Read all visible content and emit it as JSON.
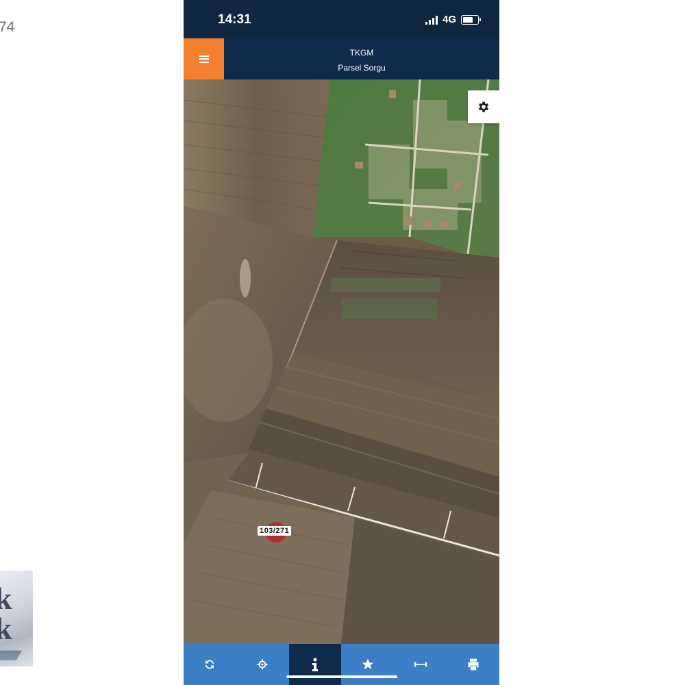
{
  "background": {
    "fragment_number": "74"
  },
  "status_bar": {
    "time": "14:31",
    "network": "4G"
  },
  "header": {
    "title": "TKGM",
    "subtitle": "Parsel Sorgu",
    "menu_icon": "hamburger-menu-icon"
  },
  "map": {
    "settings_icon": "gear-icon",
    "parcel_label": "103/271"
  },
  "toolbar": {
    "items": [
      {
        "icon": "refresh-icon",
        "active": false
      },
      {
        "icon": "locate-icon",
        "active": false
      },
      {
        "icon": "info-icon",
        "active": true
      },
      {
        "icon": "star-icon",
        "active": false
      },
      {
        "icon": "measure-icon",
        "active": false
      },
      {
        "icon": "print-icon",
        "active": false
      }
    ]
  },
  "colors": {
    "header_bg": "#0f2a4a",
    "menu_button": "#f28030",
    "toolbar_bg": "#3b7fc7",
    "toolbar_active": "#0f2a4a"
  }
}
